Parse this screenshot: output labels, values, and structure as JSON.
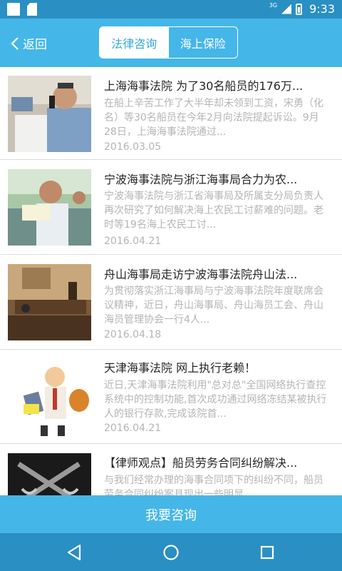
{
  "status_bar": {
    "network": "3G",
    "time": "9:33"
  },
  "nav": {
    "back_label": "返回",
    "tabs": [
      {
        "label": "法律咨询",
        "active": true
      },
      {
        "label": "海上保险",
        "active": false
      }
    ]
  },
  "articles": [
    {
      "title": "上海海事法院 为了30名船员的176万...",
      "summary": "在船上辛苦工作了大半年却未领到工资，宋勇（化名）等30名船员在今年2月向法院提起诉讼。9月28日，上海海事法院通过...",
      "date": "2016.03.05"
    },
    {
      "title": "宁波海事法院与浙江海事局合力为农...",
      "summary": "宁波海事法院与浙江省海事局及所属支分局负责人再次研究了如何解决海上农民工讨薪难的问题。老时等19名海上农民工讨...",
      "date": "2016.04.21"
    },
    {
      "title": "舟山海事局走访宁波海事法院舟山法...",
      "summary": "为贯彻落实浙江海事局与宁波海事法院年度联席会议精神，近日，舟山海事局、舟山海员工会、舟山海员管理协会一行4人...",
      "date": "2016.04.18"
    },
    {
      "title": "天津海事法院 网上执行老赖！",
      "summary": "近日,天津海事法院利用\"总对总\"全国网络执行查控系统中的控制功能,首次成功通过网络冻结某被执行人的银行存款,完成该院首...",
      "date": "2016.04.21"
    },
    {
      "title": "【律师观点】船员劳务合同纠纷解决...",
      "summary": "与我们经常办理的海事合同项下的纠纷不同，船员劳务合同纠纷案具现出一些明显...",
      "date": ""
    }
  ],
  "consult_button": "我要咨询",
  "colors": {
    "primary": "#45b6e8",
    "dark": "#2a8fc3"
  }
}
